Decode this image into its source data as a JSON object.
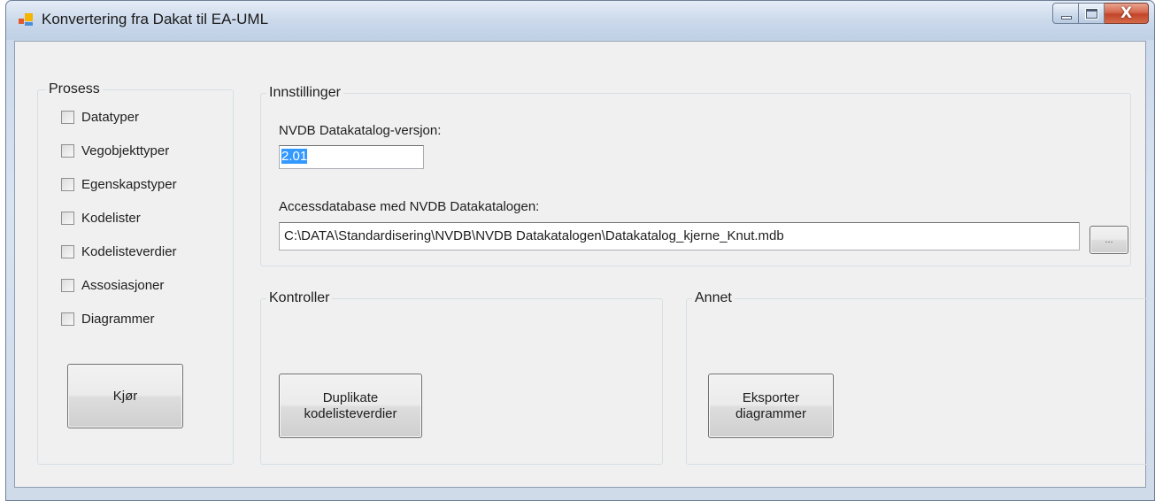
{
  "window": {
    "title": "Konvertering fra Dakat til EA-UML",
    "close_glyph": "X"
  },
  "prosess": {
    "title": "Prosess",
    "checkboxes": [
      {
        "label": "Datatyper",
        "checked": false
      },
      {
        "label": "Vegobjekttyper",
        "checked": false
      },
      {
        "label": "Egenskapstyper",
        "checked": false
      },
      {
        "label": "Kodelister",
        "checked": false
      },
      {
        "label": "Kodelisteverdier",
        "checked": false
      },
      {
        "label": "Assosiasjoner",
        "checked": false
      },
      {
        "label": "Diagrammer",
        "checked": false
      }
    ],
    "run_button": "Kjør"
  },
  "innstillinger": {
    "title": "Innstillinger",
    "version_label": "NVDB Datakatalog-versjon:",
    "version_value": "2.01",
    "db_label": "Accessdatabase med NVDB Datakatalogen:",
    "db_path": "C:\\DATA\\Standardisering\\NVDB\\NVDB Datakatalogen\\Datakatalog_kjerne_Knut.mdb",
    "browse_button": "..."
  },
  "kontroller": {
    "title": "Kontroller",
    "button_line1": "Duplikate",
    "button_line2": "kodelisteverdier"
  },
  "annet": {
    "title": "Annet",
    "button_line1": "Eksporter",
    "button_line2": "diagrammer"
  },
  "colors": {
    "selection": "#3399ff",
    "client_bg": "#f0f0f0",
    "close_button": "#c2452a"
  }
}
